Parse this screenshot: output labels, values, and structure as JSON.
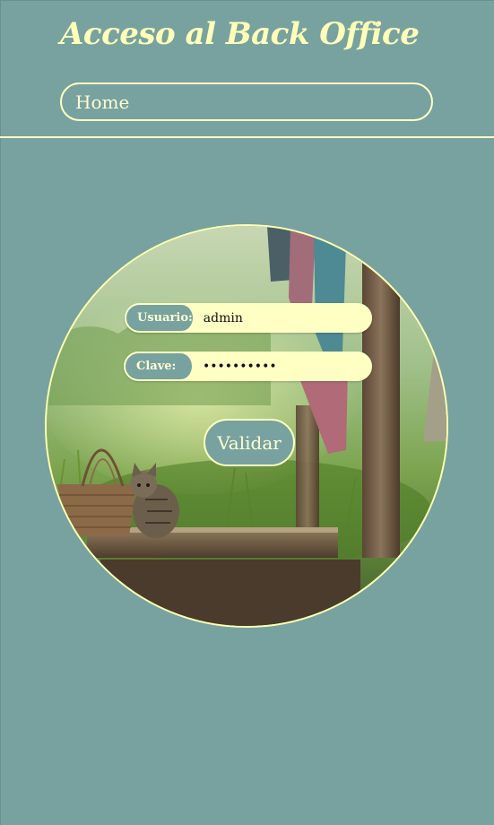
{
  "header": {
    "title": "Acceso al Back Office",
    "nav": {
      "home_label": "Home"
    }
  },
  "login": {
    "usuario_label": "Usuario:",
    "usuario_value": "admin",
    "clave_label": "Clave:",
    "clave_value": "••••••••••",
    "submit_label": "Validar"
  },
  "colors": {
    "background": "#77a29f",
    "accent": "#ffffc2",
    "input_fill": "#ffffc4"
  }
}
